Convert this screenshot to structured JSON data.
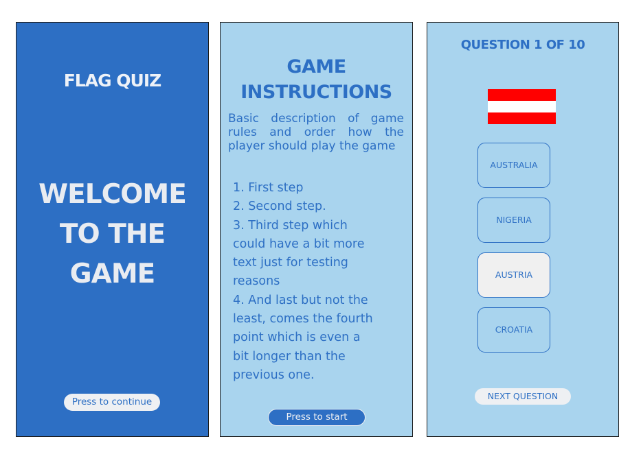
{
  "welcome_screen": {
    "title": "FLAG QUIZ",
    "welcome_lines": [
      "WELCOME",
      "TO THE",
      "GAME"
    ],
    "continue_button": "Press to continue"
  },
  "instructions_screen": {
    "title_lines": [
      "GAME",
      "INSTRUCTIONS"
    ],
    "description": "Basic description of game rules and order how the player should play the game",
    "steps": [
      "1. First step",
      "2. Second step.",
      "3. Third step which",
      "could have a bit more",
      "text just for testing",
      "reasons",
      "4. And last but not the",
      "least, comes the fourth",
      "point which is even a",
      "bit longer than the",
      "previous one."
    ],
    "start_button": "Press to start"
  },
  "question_screen": {
    "title": "QUESTION 1 OF 10",
    "flag_colors": [
      "#ff0000",
      "#ffffff",
      "#ff0000"
    ],
    "answers": [
      "AUSTRALIA",
      "NIGERIA",
      "AUSTRIA",
      "CROATIA"
    ],
    "selected_answer": "AUSTRIA",
    "next_button": "NEXT QUESTION"
  },
  "colors": {
    "primary_blue": "#2d6fc4",
    "light_blue": "#a9d4ee",
    "pill_light": "#eef0f3"
  }
}
